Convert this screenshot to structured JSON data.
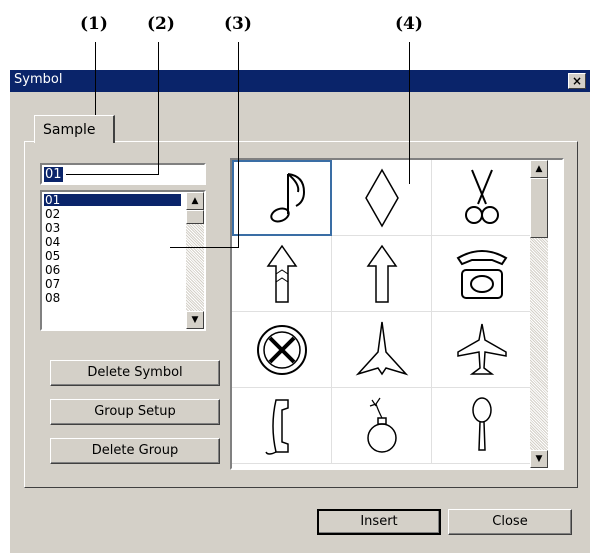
{
  "callouts": [
    "(1)",
    "(2)",
    "(3)",
    "(4)"
  ],
  "window": {
    "title": "Symbol",
    "close_glyph": "×"
  },
  "tab_label": "Sample",
  "symbol_input": {
    "value": "01"
  },
  "symbol_list": {
    "items": [
      "01",
      "02",
      "03",
      "04",
      "05",
      "06",
      "07",
      "08"
    ],
    "selected_index": 0
  },
  "buttons": {
    "delete_symbol": "Delete Symbol",
    "group_setup": "Group Setup",
    "delete_group": "Delete Group",
    "insert": "Insert",
    "close": "Close"
  },
  "symbol_grid": {
    "selected_index": 0,
    "symbols": [
      "music-note-icon",
      "diamond-icon",
      "scissors-icon",
      "arrow-up-icon",
      "arrow-up-outline-icon",
      "telephone-icon",
      "wheel-icon",
      "jet-icon",
      "airplane-icon",
      "phone-handset-icon",
      "bomb-icon",
      "spoon-icon"
    ]
  }
}
